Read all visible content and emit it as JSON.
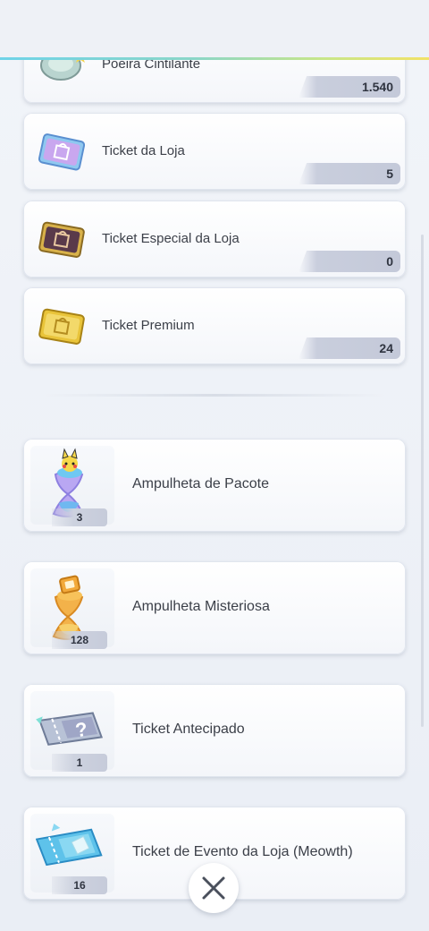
{
  "currencies": [
    {
      "label": "Poeira Cintilante",
      "count": "1.540",
      "icon": "shimmering-dust-icon"
    },
    {
      "label": "Ticket da Loja",
      "count": "5",
      "icon": "shop-ticket-icon"
    },
    {
      "label": "Ticket Especial da Loja",
      "count": "0",
      "icon": "special-shop-ticket-icon"
    },
    {
      "label": "Ticket Premium",
      "count": "24",
      "icon": "premium-ticket-icon"
    }
  ],
  "items": [
    {
      "label": "Ampulheta de Pacote",
      "qty": "3",
      "icon": "pack-hourglass-icon"
    },
    {
      "label": "Ampulheta Misteriosa",
      "qty": "128",
      "icon": "mystery-hourglass-icon"
    },
    {
      "label": "Ticket Antecipado",
      "qty": "1",
      "icon": "advance-ticket-icon"
    },
    {
      "label": "Ticket de Evento da Loja (Meowth)",
      "qty": "16",
      "icon": "event-shop-ticket-icon"
    }
  ],
  "close_button": {
    "icon": "close-icon"
  },
  "colors": {
    "accent_gradient": [
      "#6fd3e8",
      "#c7e68a",
      "#f2e266"
    ],
    "background": "#e9eef5"
  }
}
